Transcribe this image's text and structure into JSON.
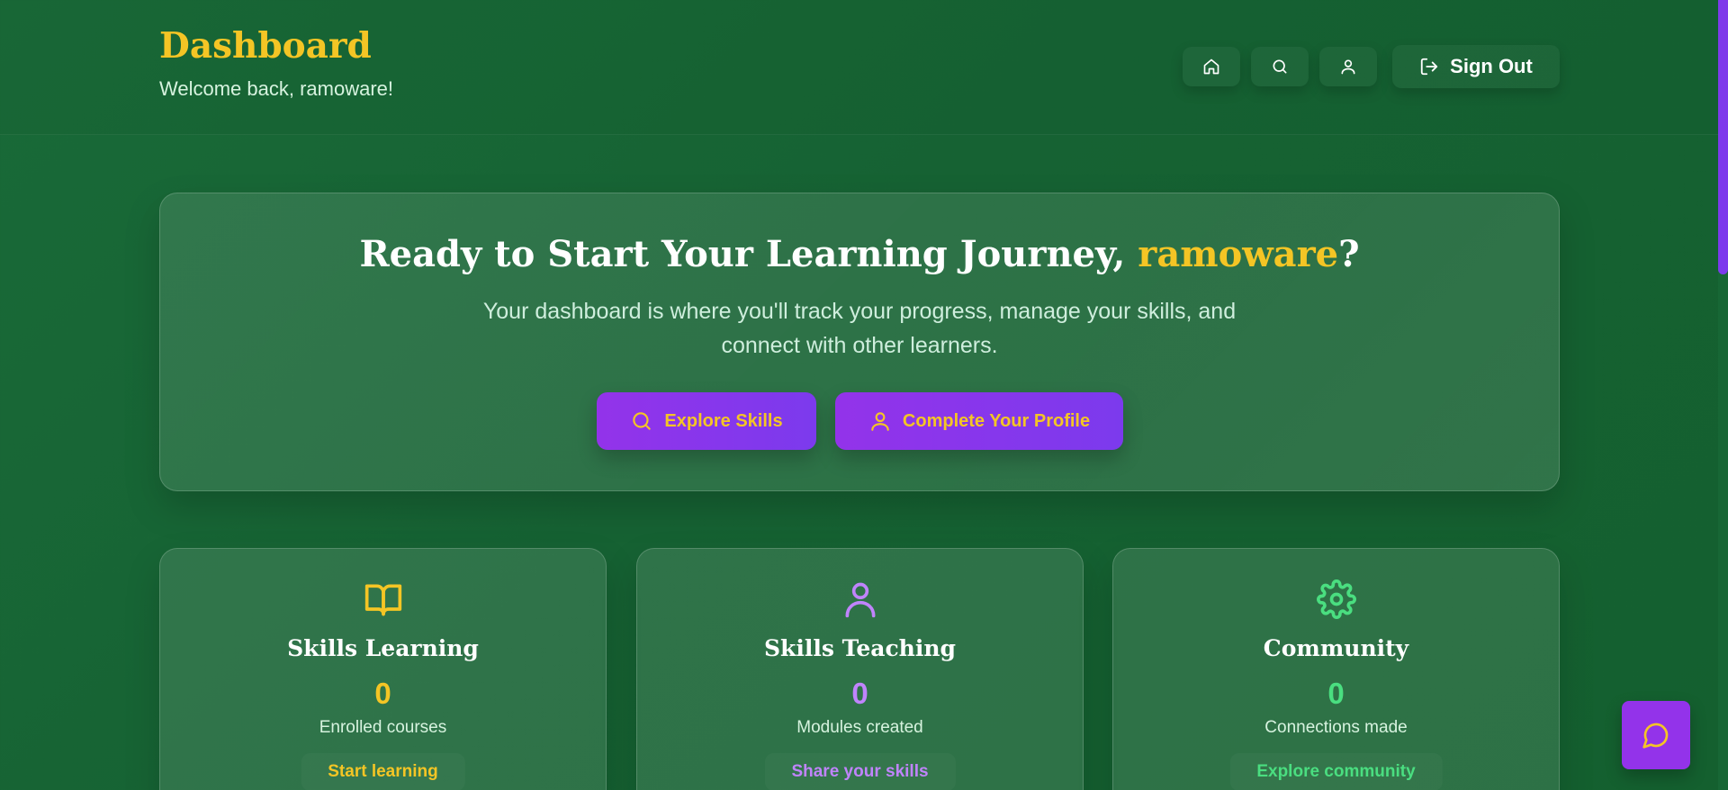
{
  "header": {
    "title": "Dashboard",
    "welcome": "Welcome back, ramoware!",
    "nav_icons": [
      "home-icon",
      "search-icon",
      "user-icon"
    ],
    "signout_label": "Sign Out"
  },
  "hero": {
    "title_prefix": "Ready to Start Your Learning Journey, ",
    "title_name": "ramoware",
    "title_suffix": "?",
    "subtitle": "Your dashboard is where you'll track your progress, manage your skills, and connect with other learners.",
    "buttons": [
      {
        "label": "Explore Skills",
        "icon": "search-icon"
      },
      {
        "label": "Complete Your Profile",
        "icon": "user-icon"
      }
    ]
  },
  "cards": [
    {
      "title": "Skills Learning",
      "count": "0",
      "description": "Enrolled courses",
      "link": "Start learning",
      "icon": "book-open-icon",
      "accent": "#f4c525"
    },
    {
      "title": "Skills Teaching",
      "count": "0",
      "description": "Modules created",
      "link": "Share your skills",
      "icon": "user-icon",
      "accent": "#c084fc"
    },
    {
      "title": "Community",
      "count": "0",
      "description": "Connections made",
      "link": "Explore community",
      "icon": "gear-icon",
      "accent": "#4ade80"
    }
  ],
  "chat": {
    "icon": "chat-bubble-icon"
  },
  "colors": {
    "background": "#176634",
    "accent_yellow": "#f4c525",
    "accent_purple": "#9333ea",
    "accent_green": "#4ade80"
  }
}
